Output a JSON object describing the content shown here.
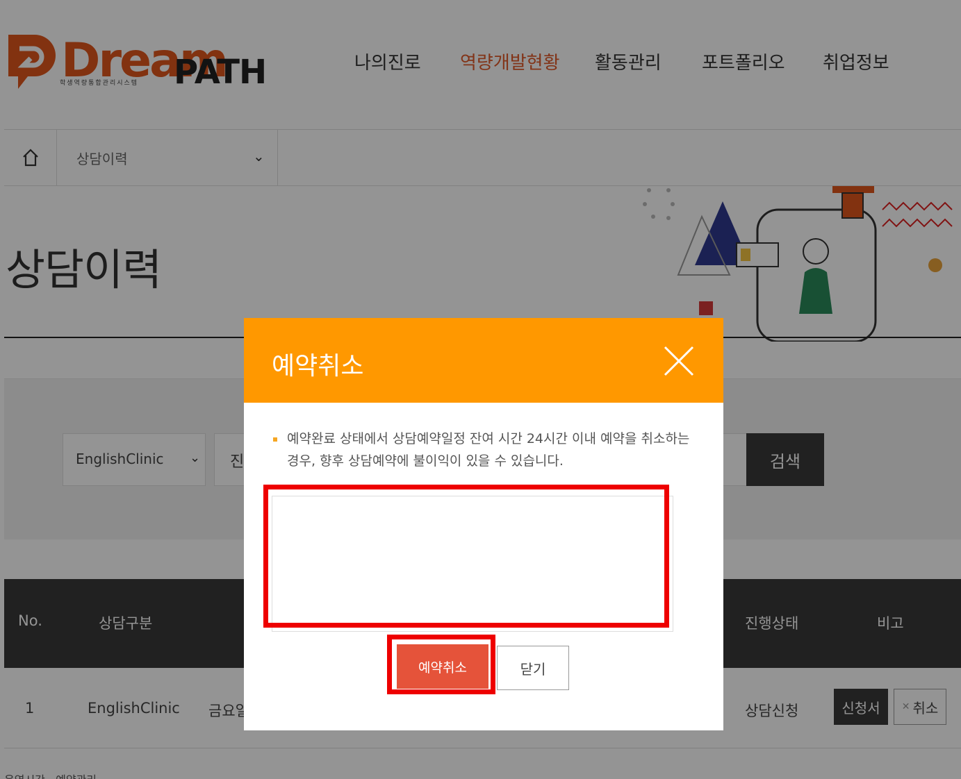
{
  "logo": {
    "dream": "Dream",
    "path": "PATH",
    "sub": "학생역량통합관리시스템"
  },
  "gnb": [
    {
      "label": "나의진로",
      "active": false
    },
    {
      "label": "역량개발현황",
      "active": true
    },
    {
      "label": "활동관리",
      "active": false
    },
    {
      "label": "포트폴리오",
      "active": false
    },
    {
      "label": "취업정보",
      "active": false
    }
  ],
  "breadcrumb": {
    "home_icon": "home-icon",
    "current": "상담이력"
  },
  "page_title": "상담이력",
  "search": {
    "category": "EnglishClinic",
    "status_partial": "진",
    "button": "검색"
  },
  "table": {
    "headers": {
      "no": "No.",
      "type": "상담구분",
      "status": "진행상태",
      "note": "비고"
    },
    "rows": [
      {
        "no": "1",
        "type": "EnglishClinic",
        "date_partial": "금요일",
        "status": "상담신청",
        "apply_btn": "신청서",
        "cancel_btn": "취소"
      }
    ]
  },
  "footer_partial": "운영시간 · 예약관리",
  "modal": {
    "title": "예약취소",
    "close_icon": "close-icon",
    "notice": "예약완료 상태에서 상담예약일정 잔여 시간 24시간 이내 예약을 취소하는 경우, 향후 상담예약에 불이익이 있을 수 있습니다.",
    "reason_value": "",
    "confirm": "예약취소",
    "close": "닫기"
  },
  "colors": {
    "accent": "#ff9800",
    "brand": "#e0561d",
    "confirm": "#e5533a",
    "highlight": "#ee0000",
    "dark": "#3a3a3a"
  }
}
